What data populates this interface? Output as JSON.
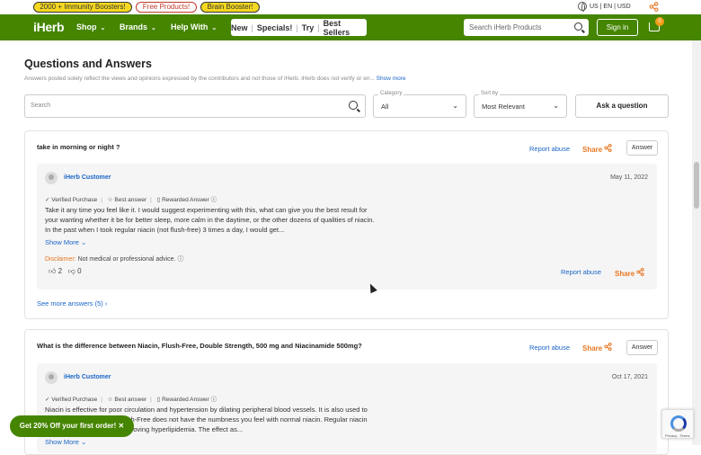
{
  "promo": {
    "pills": [
      "2000 + Immunity Boosters!",
      "Free Products!",
      "Brain Booster!"
    ],
    "locale": "US | EN | USD"
  },
  "nav": {
    "logo": "iHerb",
    "items": [
      "Shop",
      "Brands",
      "Help With"
    ],
    "specials": [
      "New",
      "Specials!",
      "Try",
      "Best Sellers"
    ],
    "search_placeholder": "Search iHerb Products",
    "signin": "Sign in",
    "cart_count": "0"
  },
  "qa": {
    "title": "Questions and Answers",
    "disclaimer": "Answers posted solely reflect the views and opinions expressed by the contributors and not those of iHerb. iHerb does not verify or en...",
    "show_more": "Show more",
    "search_placeholder": "Search",
    "category_label": "Category",
    "category_value": "All",
    "sort_label": "Sort by",
    "sort_value": "Most Relevant",
    "ask_button": "Ask a question"
  },
  "questions": [
    {
      "question": "take in morning or night ?",
      "report": "Report abuse",
      "share": "Share",
      "answer_btn": "Answer",
      "author": "iHerb Customer",
      "date": "May 11, 2022",
      "badges": [
        "Verified Purchase",
        "Best answer",
        "Rewarded Answer"
      ],
      "body": "Take it any time you feel like it. I would suggest experimenting with this, what can give you the best result for your wanting whether it be for better sleep, more calm in the daytime, or the other dozens of qualities of niacin. In the past when I took regular niacin (not flush-free) 3 times a day, I would get...",
      "show_more": "Show More",
      "disclaimer_label": "Disclaimer:",
      "disclaimer_text": "Not medical or professional advice.",
      "upvotes": "2",
      "downvotes": "0",
      "see_more": "See more answers (5)"
    },
    {
      "question": "What is the difference between Niacin, Flush-Free, Double Strength, 500 mg and Niacinamide 500mg?",
      "report": "Report abuse",
      "share": "Share",
      "answer_btn": "Answer",
      "author": "iHerb Customer",
      "date": "Oct 17, 2021",
      "badges": [
        "Verified Purchase",
        "Best answer",
        "Rewarded Answer"
      ],
      "body": "Niacin is effective for poor circulation and hypertension by dilating peripheral blood vessels. It is also used to improve hyperlipidemia. Flush-Free does not have the numbness you feel with normal niacin. Regular niacin may be more effective in improving hyperlipidemia. The effect as...",
      "show_more": "Show More"
    }
  ],
  "coupon": "Get 20% Off your first order!",
  "recaptcha": "Privacy - Terms"
}
